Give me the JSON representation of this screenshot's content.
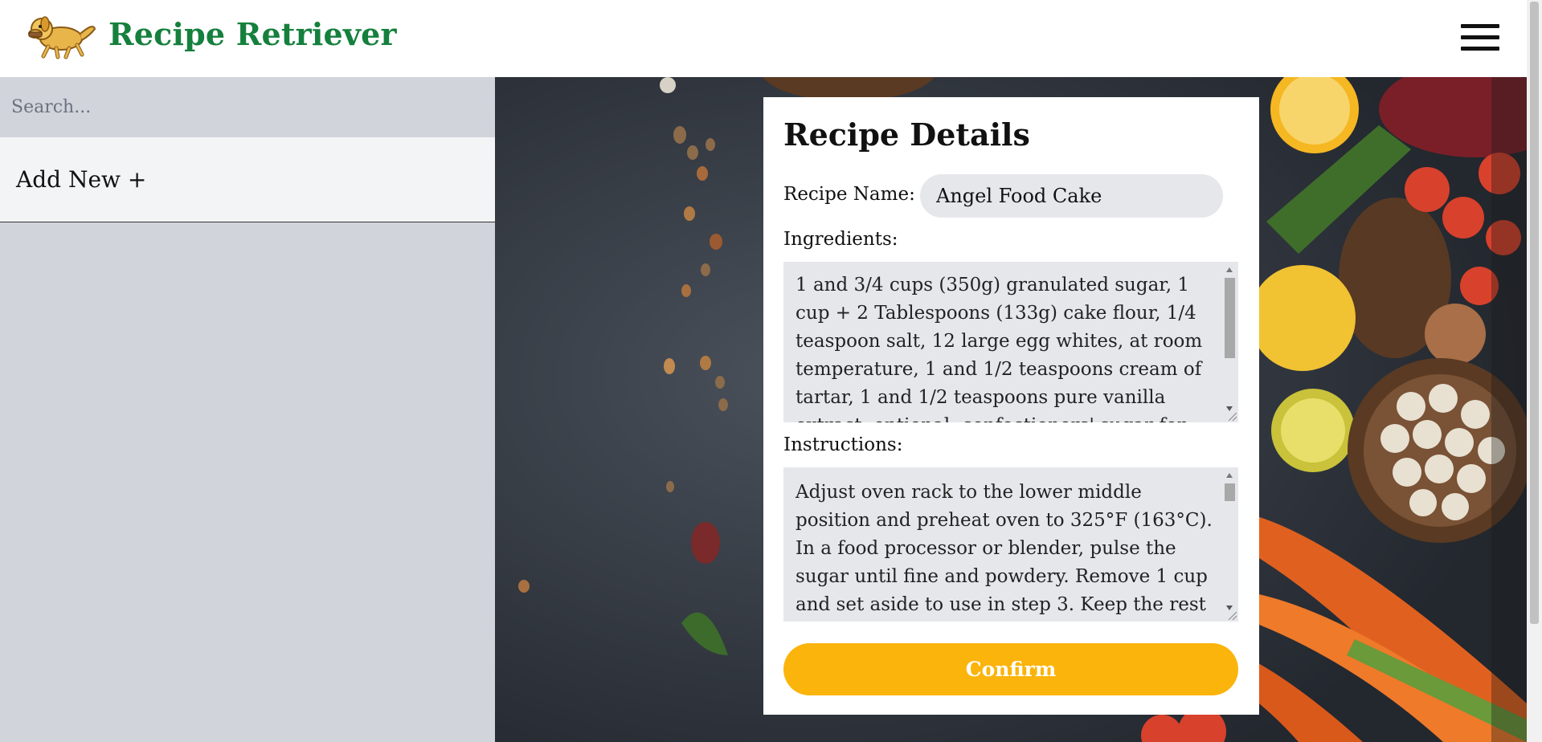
{
  "header": {
    "app_title": "Recipe Retriever",
    "logo_icon": "golden-retriever-logo-icon",
    "menu_icon": "hamburger-menu-icon",
    "brand_color": "#15803d"
  },
  "sidebar": {
    "search_placeholder": "Search...",
    "add_new_label": "Add New +"
  },
  "modal": {
    "title": "Recipe Details",
    "recipe_name_label": "Recipe Name:",
    "recipe_name_value": "Angel Food Cake",
    "ingredients_label": "Ingredients:",
    "ingredients_value": "1 and 3/4 cups (350g) granulated sugar, 1 cup + 2 Tablespoons (133g) cake flour, 1/4 teaspoon salt, 12 large egg whites, at room temperature, 1 and 1/2 teaspoons cream of tartar, 1 and 1/2 teaspoons pure vanilla extract, optional: confectioners' sugar for",
    "instructions_label": "Instructions:",
    "instructions_value": "Adjust oven rack to the lower middle position and preheat oven to 325°F (163°C). In a food processor or blender, pulse the sugar until fine and powdery. Remove 1 cup and set aside to use in step 3. Keep the rest in the food",
    "confirm_label": "Confirm",
    "confirm_color": "#fbb40b"
  }
}
